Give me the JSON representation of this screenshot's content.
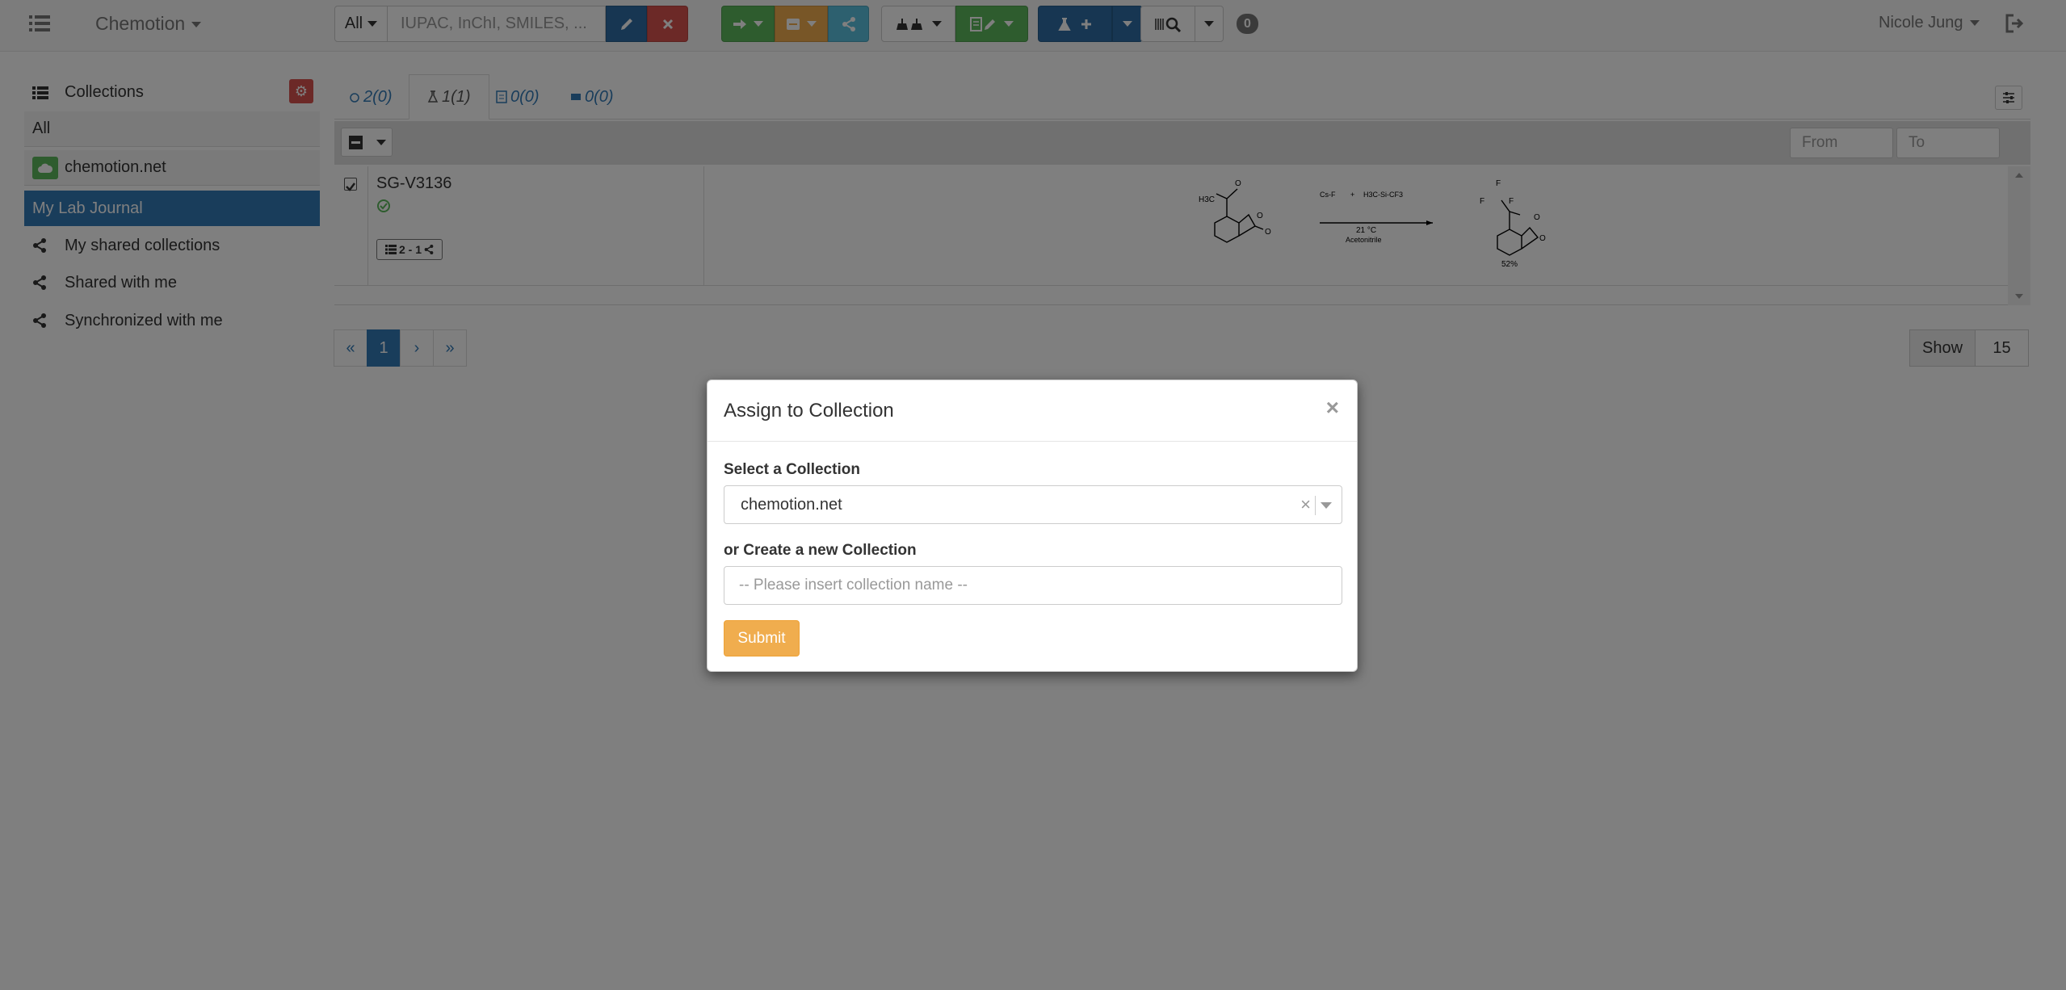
{
  "navbar": {
    "brand": "Chemotion",
    "search_scope": "All",
    "search_placeholder": "IUPAC, InChI, SMILES, ...",
    "badge_count": "0",
    "user_name": "Nicole Jung",
    "colors": {
      "blue": "#2e6da4",
      "red": "#d9534f",
      "green": "#5cb85c",
      "orange": "#f0ad4e",
      "teal": "#5bc0de"
    }
  },
  "sidebar": {
    "header": "Collections",
    "all": "All",
    "synced_collection": "chemotion.net",
    "active_item": "My Lab Journal",
    "links": [
      "My shared collections",
      "Shared with me",
      "Synchronized with me"
    ]
  },
  "tabs": [
    {
      "label": "2(0)",
      "icon": "sample-icon"
    },
    {
      "label": "1(1)",
      "icon": "reaction-icon"
    },
    {
      "label": "0(0)",
      "icon": "wellplate-icon"
    },
    {
      "label": "0(0)",
      "icon": "screen-icon"
    }
  ],
  "filters": {
    "from_placeholder": "From",
    "to_placeholder": "To"
  },
  "reaction_row": {
    "name": "SG-V3136",
    "tag": "2 - 1",
    "scheme": {
      "reactant_label": "H3C",
      "reagent_left": "Cs-F",
      "reagent_right": "H3C-Si-CF3",
      "conditions_temp": "21 °C",
      "conditions_solvent": "Acetonitrile",
      "yield": "52%"
    }
  },
  "pagination": {
    "prev_first": "«",
    "page": "1",
    "next": "›",
    "next_last": "»"
  },
  "show": {
    "label": "Show",
    "value": "15"
  },
  "modal": {
    "title": "Assign to Collection",
    "close": "×",
    "select_label": "Select a Collection",
    "selected_value": "chemotion.net",
    "create_label": "or Create a new Collection",
    "create_placeholder": "-- Please insert collection name --",
    "submit": "Submit"
  }
}
